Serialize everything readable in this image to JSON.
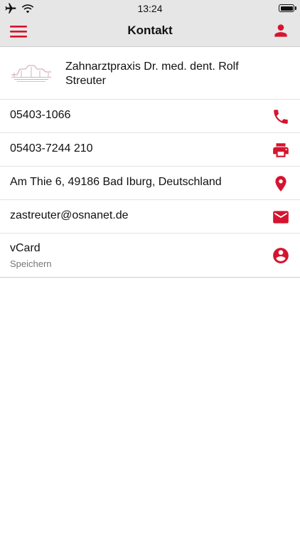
{
  "status_bar": {
    "time": "13:24",
    "icons": [
      "airplane-icon",
      "wifi-icon",
      "battery-icon"
    ]
  },
  "nav": {
    "title": "Kontakt",
    "left_icon": "menu-icon",
    "right_icon": "person-icon"
  },
  "header": {
    "name": "Zahnarztpraxis Dr. med. dent. Rolf Streuter"
  },
  "rows": [
    {
      "text": "05403-1066",
      "icon": "phone-icon"
    },
    {
      "text": "05403-7244 210",
      "icon": "fax-icon"
    },
    {
      "text": "Am Thie 6, 49186 Bad Iburg, Deutschland",
      "icon": "location-icon"
    },
    {
      "text": "zastreuter@osnanet.de",
      "icon": "mail-icon"
    }
  ],
  "vcard": {
    "title": "vCard",
    "subtitle": "Speichern",
    "icon": "account-circle-icon"
  },
  "colors": {
    "accent": "#d5142f",
    "bar_bg": "#e6e6e6",
    "divider": "#e2e2e2"
  }
}
